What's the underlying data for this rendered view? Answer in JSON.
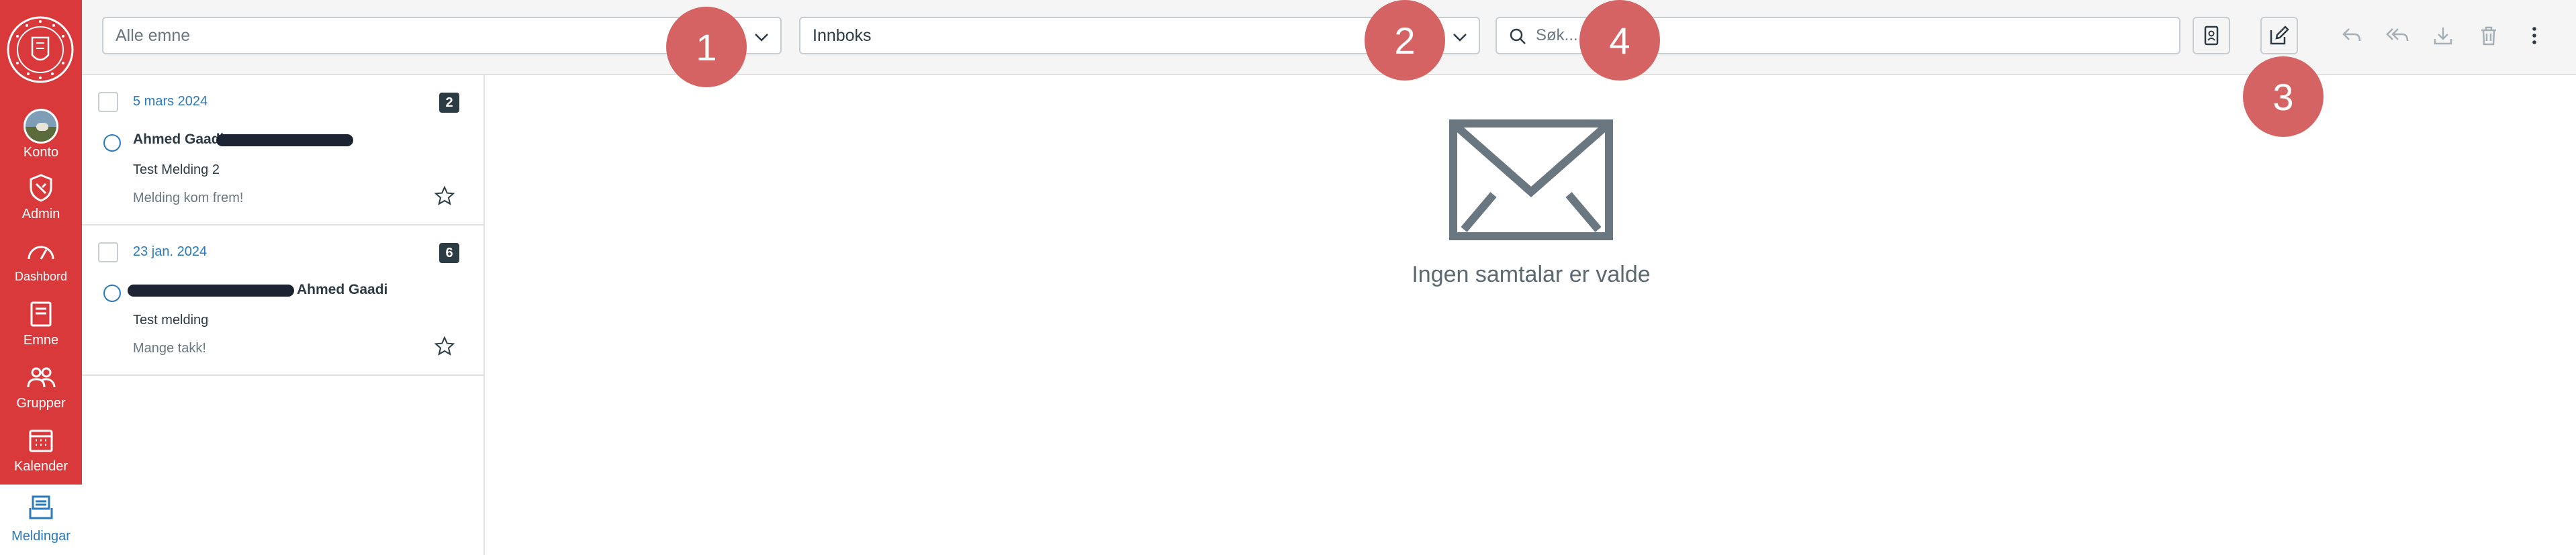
{
  "nav": {
    "items": [
      {
        "label": "Konto",
        "icon": "account-avatar"
      },
      {
        "label": "Admin",
        "icon": "admin-shield-icon"
      },
      {
        "label": "Dashbord",
        "icon": "dashboard-gauge-icon"
      },
      {
        "label": "Emne",
        "icon": "courses-book-icon"
      },
      {
        "label": "Grupper",
        "icon": "groups-people-icon"
      },
      {
        "label": "Kalender",
        "icon": "calendar-icon"
      },
      {
        "label": "Meldingar",
        "icon": "inbox-icon"
      }
    ],
    "active": "Meldingar"
  },
  "toolbar": {
    "course_filter": {
      "value": "Alle emne"
    },
    "mailbox_filter": {
      "value": "Innboks"
    },
    "search": {
      "placeholder": "Søk..."
    },
    "icons": [
      "address-book-icon",
      "compose-icon",
      "reply-icon",
      "reply-all-icon",
      "archive-icon",
      "delete-icon",
      "more-options-icon"
    ]
  },
  "annotations": [
    "1",
    "2",
    "3",
    "4"
  ],
  "conversations": [
    {
      "date": "5 mars 2024",
      "count": "2",
      "participants": "Ahmed Gaadi",
      "subject": "Test Melding 2",
      "preview": "Melding kom frem!"
    },
    {
      "date": "23 jan. 2024",
      "count": "6",
      "participants": "Ahmed Gaadi",
      "subject": "Test melding",
      "preview": "Mange takk!"
    }
  ],
  "empty_state": {
    "text": "Ingen samtalar er valde",
    "icon": "envelope-icon"
  },
  "colors": {
    "nav_bg": "#d9393a",
    "accent": "#2b7abc",
    "badge": "#d66363",
    "text": "#2d3b45"
  }
}
